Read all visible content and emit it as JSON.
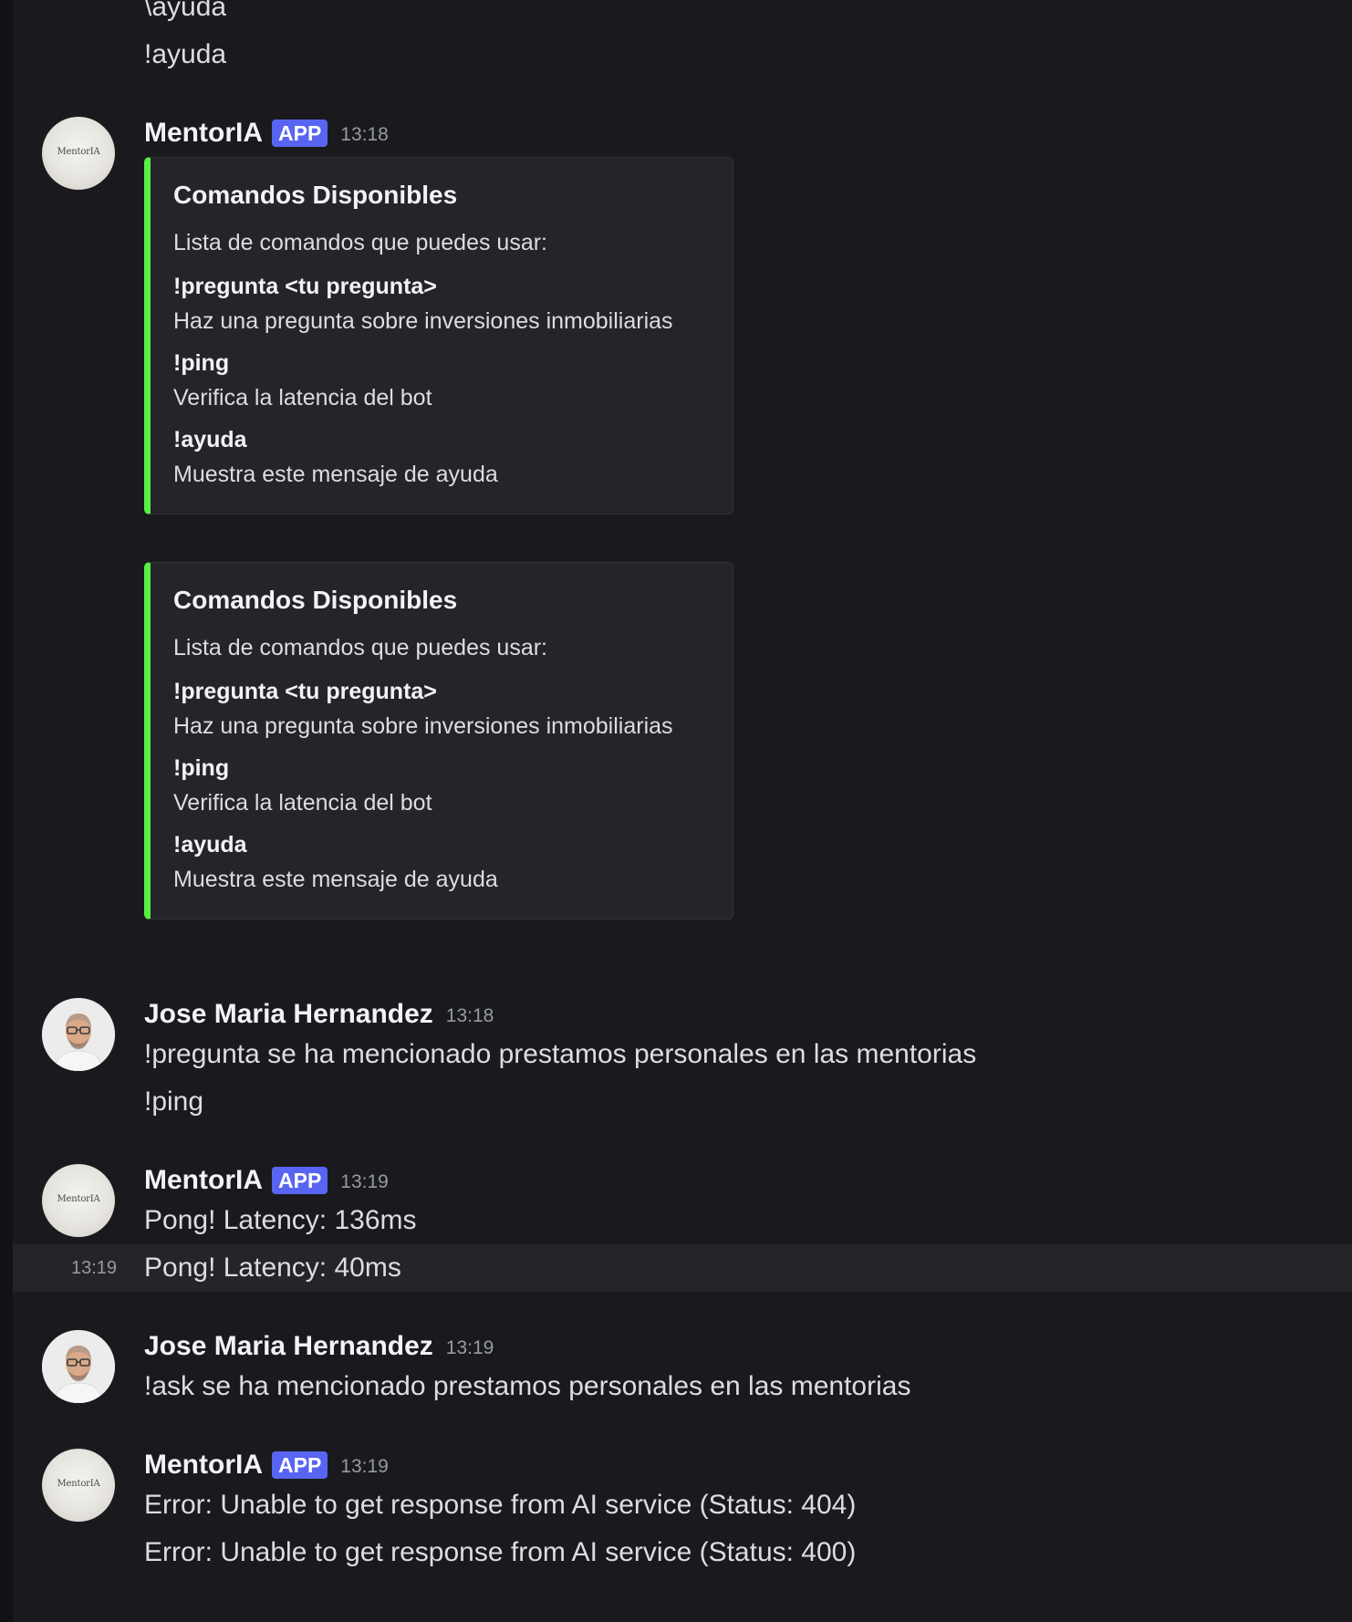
{
  "messages": {
    "top_lines": [
      "\\ayuda",
      "!ayuda"
    ],
    "bot_msg_1": {
      "author": "MentorIA",
      "badge": "APP",
      "time": "13:18",
      "avatar_text": "MentorIA",
      "embeds": [
        {
          "title": "Comandos Disponibles",
          "description": "Lista de comandos que puedes usar:",
          "fields": [
            {
              "name": "!pregunta <tu pregunta>",
              "value": "Haz una pregunta sobre inversiones inmobiliarias"
            },
            {
              "name": "!ping",
              "value": "Verifica la latencia del bot"
            },
            {
              "name": "!ayuda",
              "value": "Muestra este mensaje de ayuda"
            }
          ]
        },
        {
          "title": "Comandos Disponibles",
          "description": "Lista de comandos que puedes usar:",
          "fields": [
            {
              "name": "!pregunta <tu pregunta>",
              "value": "Haz una pregunta sobre inversiones inmobiliarias"
            },
            {
              "name": "!ping",
              "value": "Verifica la latencia del bot"
            },
            {
              "name": "!ayuda",
              "value": "Muestra este mensaje de ayuda"
            }
          ]
        }
      ]
    },
    "user_msg_1": {
      "author": "Jose Maria Hernandez",
      "time": "13:18",
      "lines": [
        "!pregunta se ha mencionado prestamos personales en las mentorias",
        "!ping"
      ]
    },
    "bot_msg_2": {
      "author": "MentorIA",
      "badge": "APP",
      "time": "13:19",
      "avatar_text": "MentorIA",
      "lines": [
        "Pong! Latency: 136ms",
        "Pong! Latency: 40ms"
      ],
      "hover_time": "13:19"
    },
    "user_msg_2": {
      "author": "Jose Maria Hernandez",
      "time": "13:19",
      "lines": [
        "!ask se ha mencionado prestamos personales en las mentorias"
      ]
    },
    "bot_msg_3": {
      "author": "MentorIA",
      "badge": "APP",
      "time": "13:19",
      "avatar_text": "MentorIA",
      "lines": [
        "Error: Unable to get response from AI service (Status: 404)",
        "Error: Unable to get response from AI service (Status: 400)"
      ]
    }
  },
  "colors": {
    "background": "#1a1a1e",
    "embed_accent": "#57f043",
    "app_badge": "#5865f2"
  }
}
